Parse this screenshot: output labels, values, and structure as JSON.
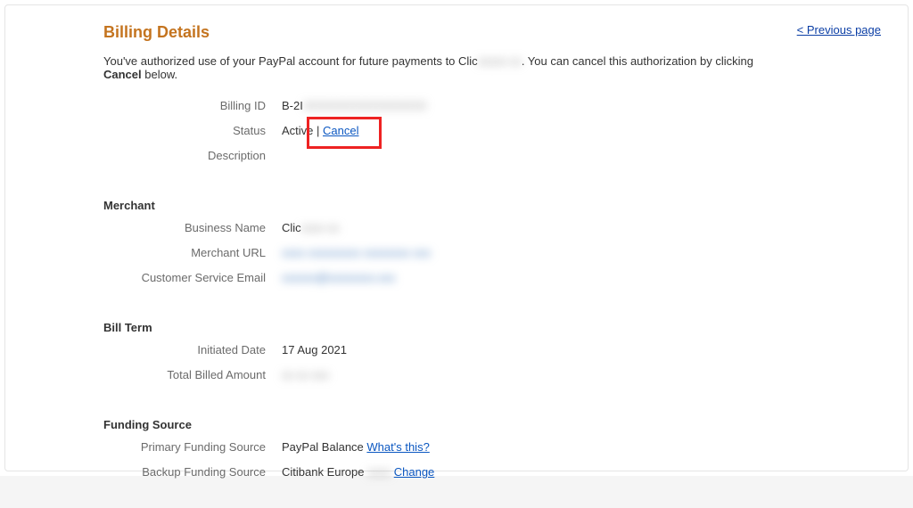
{
  "header": {
    "title": "Billing Details",
    "previous": "< Previous page"
  },
  "intro": {
    "part1": "You've authorized use of your PayPal account for future payments to Clic",
    "redactedMerchant": "xxxxx xx",
    "part2": ". You can cancel this authorization by clicking ",
    "cancelWord": "Cancel",
    "part3": " below."
  },
  "details": {
    "billingIdLabel": "Billing ID",
    "billingIdValue": "B-2I",
    "billingIdRedacted": "XXXXXXXXXXXXXXXX",
    "statusLabel": "Status",
    "statusValue": "Active",
    "statusSep": " | ",
    "cancelLink": "Cancel",
    "descriptionLabel": "Description",
    "descriptionValue": ""
  },
  "merchant": {
    "sectionTitle": "Merchant",
    "businessNameLabel": "Business Name",
    "businessNameValue": "Clic",
    "businessNameRedacted": "xxxx xx",
    "merchantUrlLabel": "Merchant URL",
    "merchantUrlRedacted": "xxxx xxxxxxxxx xxxxxxxx xxx",
    "emailLabel": "Customer Service Email",
    "emailRedacted": "xxxxxx@xxxxxxxx.xxx"
  },
  "billTerm": {
    "sectionTitle": "Bill Term",
    "initiatedLabel": "Initiated Date",
    "initiatedValue": "17 Aug 2021",
    "totalLabel": "Total Billed Amount",
    "totalRedacted": "xx xx xxx"
  },
  "funding": {
    "sectionTitle": "Funding Source",
    "primaryLabel": "Primary Funding Source",
    "primaryValue": "PayPal Balance ",
    "whatsThis": "What's this?",
    "backupLabel": "Backup Funding Source",
    "backupValue": "Citibank Europe",
    "backupRedacted": " xxxx ",
    "changeLink": "Change"
  }
}
